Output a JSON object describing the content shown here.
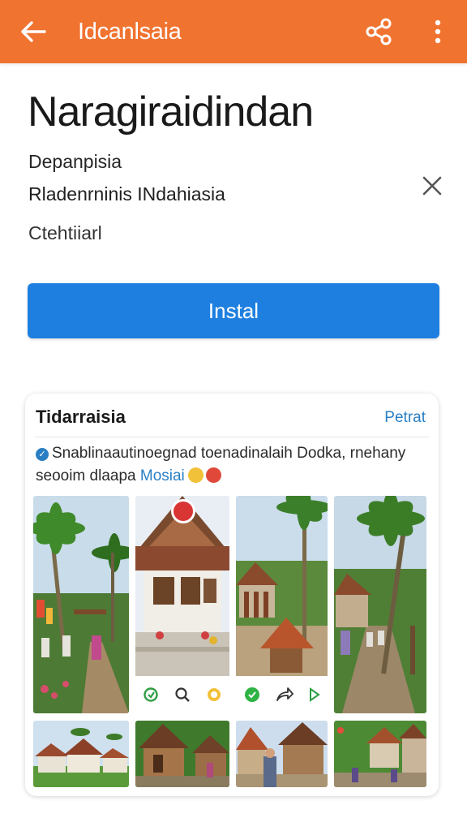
{
  "appbar": {
    "title": "Idcanlsaia",
    "background": "#f07330",
    "back_icon": "arrow-left-icon",
    "share_icon": "share-icon",
    "more_icon": "more-vertical-icon"
  },
  "app": {
    "name": "Naragiraidindan",
    "developer": "Depanpisia",
    "region": "Rladenrninis INdahiasia",
    "category": "Ctehtiiarl"
  },
  "install": {
    "label": "Instal",
    "color": "#1e7fe0"
  },
  "preview": {
    "title": "Tidarraisia",
    "link": "Petrat",
    "description_line1": "Snablinaautinoegnad toenadinalaih Dodka, rnehany",
    "description_line2": "seooim dlaapa",
    "description_link": "Mosiai",
    "screenshots_top": [
      {
        "name": "palm-village-path"
      },
      {
        "name": "traditional-house",
        "actions": [
          "refresh-icon",
          "search-icon",
          "chat-icon"
        ]
      },
      {
        "name": "courtyard-shrine",
        "actions": [
          "whatsapp-icon",
          "share-arrow-icon",
          "play-icon"
        ]
      },
      {
        "name": "palm-walkway"
      }
    ],
    "screenshots_bottom": [
      {
        "name": "village-lawn"
      },
      {
        "name": "wooden-hut"
      },
      {
        "name": "market-street"
      },
      {
        "name": "forest-houses"
      }
    ]
  }
}
